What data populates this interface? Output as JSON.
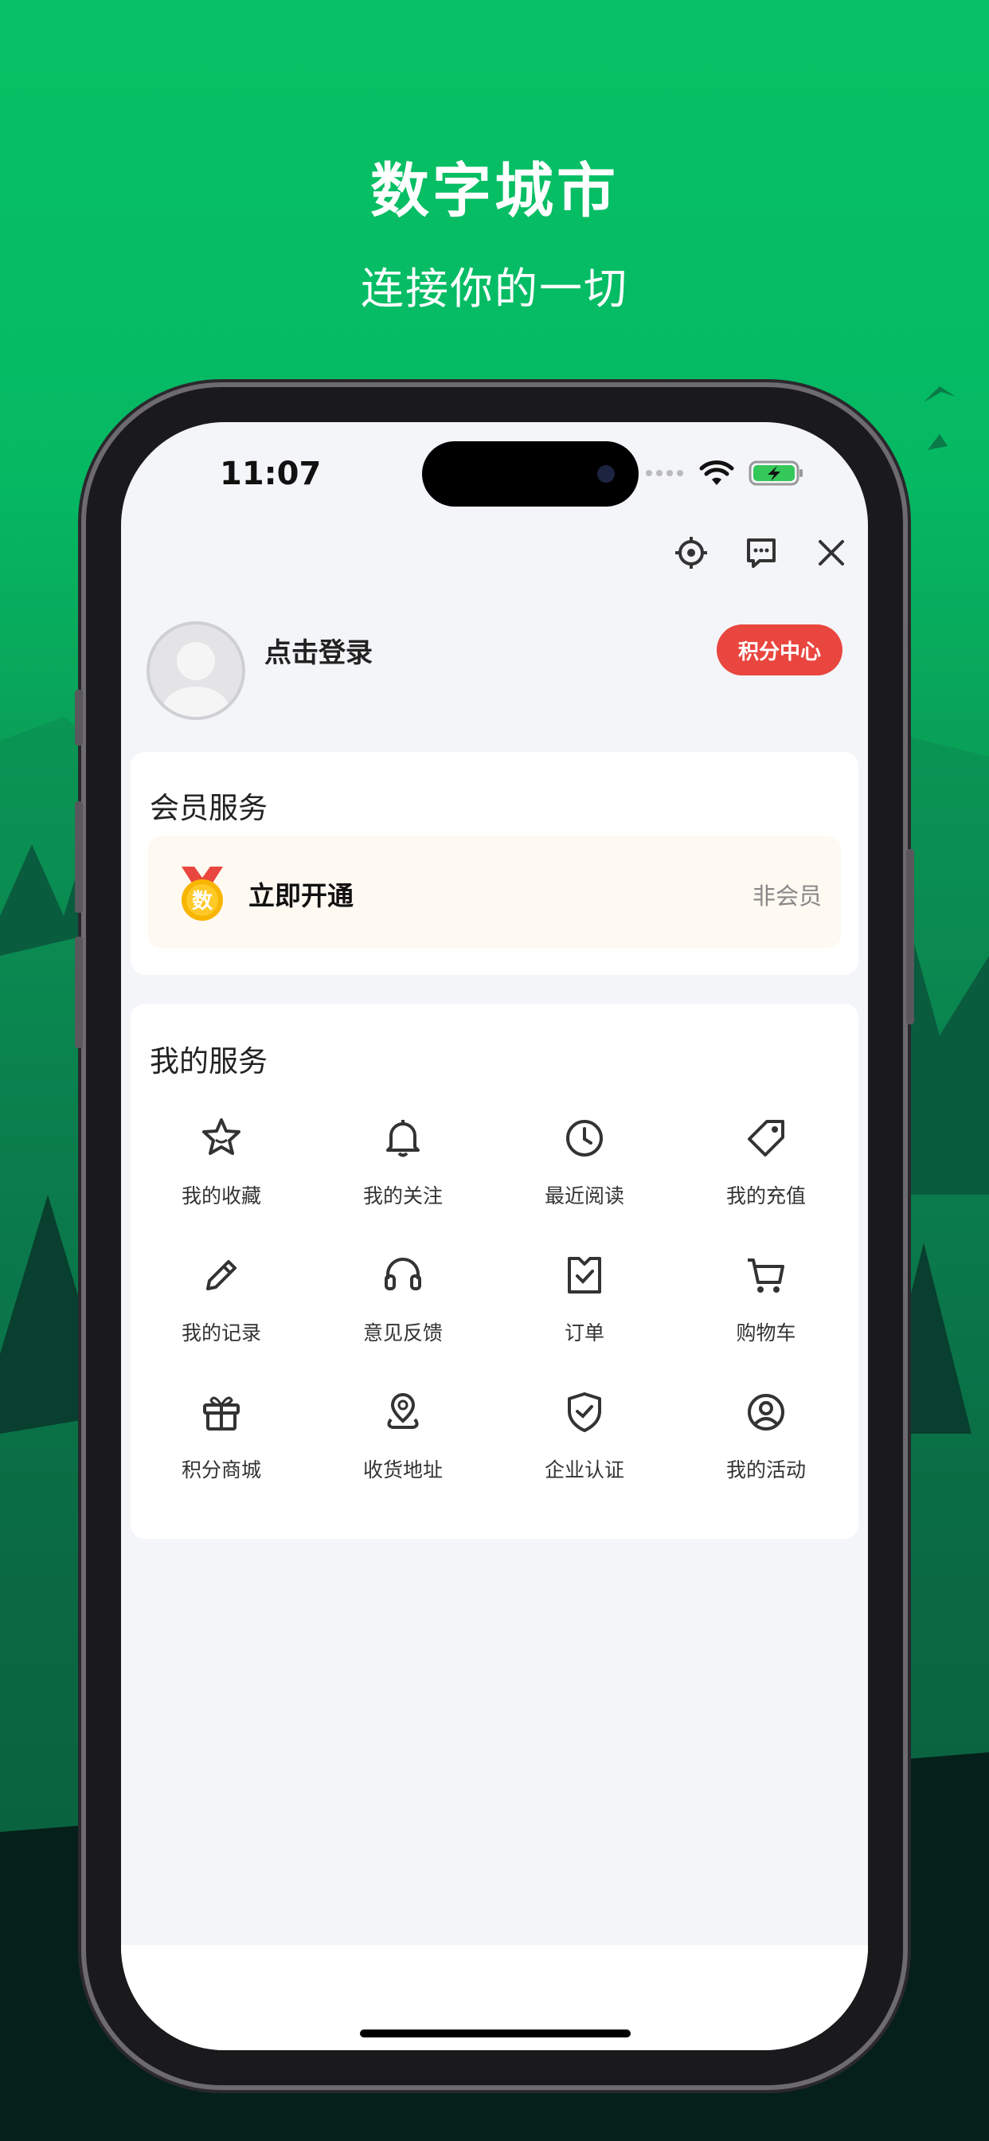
{
  "hero": {
    "title": "数字城市",
    "subtitle": "连接你的一切"
  },
  "status_bar": {
    "time": "11:07"
  },
  "profile": {
    "login_text": "点击登录",
    "points_button": "积分中心"
  },
  "member_card": {
    "title": "会员服务",
    "medal_char": "数",
    "action": "立即开通",
    "status": "非会员"
  },
  "services": {
    "title": "我的服务",
    "items": [
      {
        "label": "我的收藏",
        "icon": "star-icon"
      },
      {
        "label": "我的关注",
        "icon": "bell-icon"
      },
      {
        "label": "最近阅读",
        "icon": "clock-icon"
      },
      {
        "label": "我的充值",
        "icon": "tag-icon"
      },
      {
        "label": "我的记录",
        "icon": "pencil-icon"
      },
      {
        "label": "意见反馈",
        "icon": "headset-icon"
      },
      {
        "label": "订单",
        "icon": "order-icon"
      },
      {
        "label": "购物车",
        "icon": "cart-icon"
      },
      {
        "label": "积分商城",
        "icon": "gift-icon"
      },
      {
        "label": "收货地址",
        "icon": "location-icon"
      },
      {
        "label": "企业认证",
        "icon": "shield-check-icon"
      },
      {
        "label": "我的活动",
        "icon": "user-circle-icon"
      }
    ]
  },
  "colors": {
    "brand_green": "#06c165",
    "points_red": "#e9463f",
    "member_bg": "#fef9f1"
  }
}
